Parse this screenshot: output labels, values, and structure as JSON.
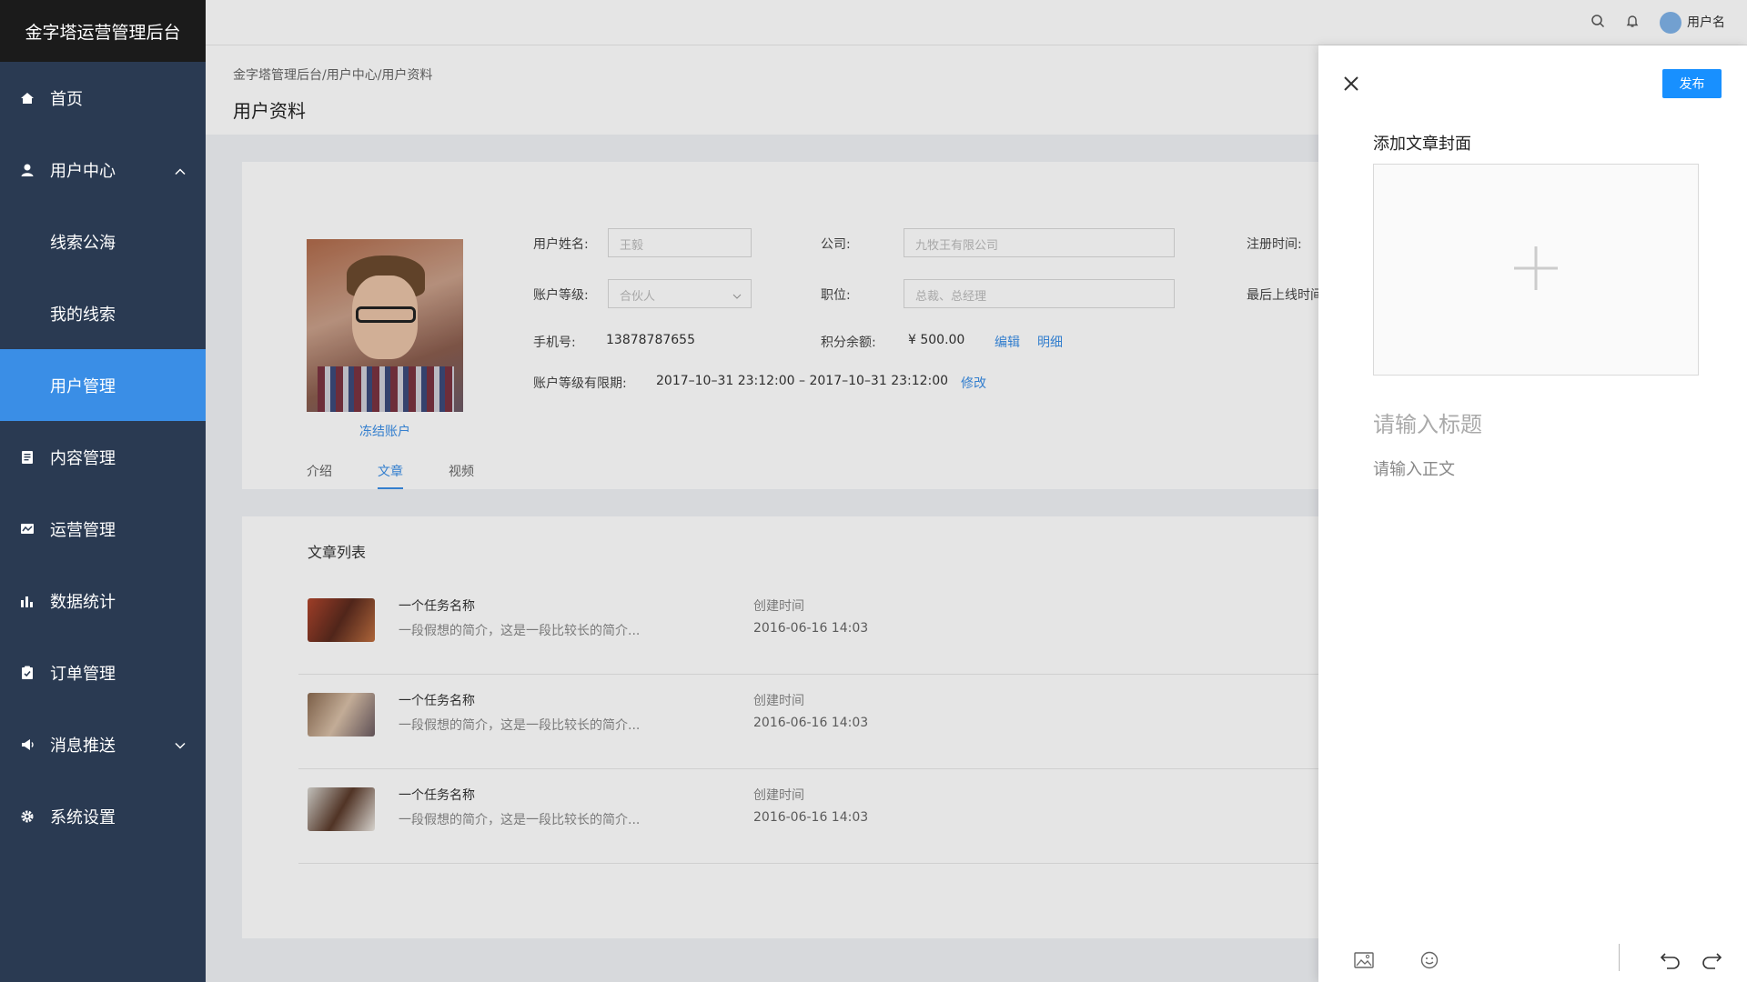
{
  "app": {
    "title": "金字塔运营管理后台"
  },
  "sidebar": {
    "items": [
      {
        "label": "首页",
        "icon": "home-icon"
      },
      {
        "label": "用户中心",
        "icon": "user-icon"
      },
      {
        "label": "线索公海"
      },
      {
        "label": "我的线索"
      },
      {
        "label": "用户管理"
      },
      {
        "label": "内容管理",
        "icon": "document-icon"
      },
      {
        "label": "运营管理",
        "icon": "flag-icon"
      },
      {
        "label": "数据统计",
        "icon": "bar-chart-icon"
      },
      {
        "label": "订单管理",
        "icon": "clipboard-icon"
      },
      {
        "label": "消息推送",
        "icon": "megaphone-icon"
      },
      {
        "label": "系统设置",
        "icon": "gear-icon"
      }
    ]
  },
  "topbar": {
    "username": "用户名"
  },
  "breadcrumb": "金字塔管理后台/用户中心/用户资料",
  "page_title": "用户资料",
  "profile": {
    "freeze_label": "冻结账户",
    "name_label": "用户姓名:",
    "name_value": "王毅",
    "level_label": "账户等级:",
    "level_value": "合伙人",
    "phone_label": "手机号:",
    "phone_value": "13878787655",
    "company_label": "公司:",
    "company_value": "九牧王有限公司",
    "position_label": "职位:",
    "position_value": "总裁、总经理",
    "points_label": "积分余额:",
    "points_value": "¥ 500.00",
    "edit_label": "编辑",
    "detail_label": "明细",
    "reg_label": "注册时间:",
    "lastlogin_label": "最后上线时间",
    "validity_label": "账户等级有限期:",
    "validity_value": "2017–10–31  23:12:00 – 2017–10–31  23:12:00",
    "modify_label": "修改"
  },
  "tabs": [
    "介绍",
    "文章",
    "视频"
  ],
  "articles": {
    "title": "文章列表",
    "rows": [
      {
        "name": "一个任务名称",
        "desc": "一段假想的简介，这是一段比较长的简介...",
        "time_label": "创建时间",
        "time": "2016-06-16  14:03"
      },
      {
        "name": "一个任务名称",
        "desc": "一段假想的简介，这是一段比较长的简介...",
        "time_label": "创建时间",
        "time": "2016-06-16  14:03"
      },
      {
        "name": "一个任务名称",
        "desc": "一段假想的简介，这是一段比较长的简介...",
        "time_label": "创建时间",
        "time": "2016-06-16  14:03"
      }
    ]
  },
  "drawer": {
    "publish_label": "发布",
    "cover_label": "添加文章封面",
    "title_placeholder": "请输入标题",
    "body_placeholder": "请输入正文"
  }
}
